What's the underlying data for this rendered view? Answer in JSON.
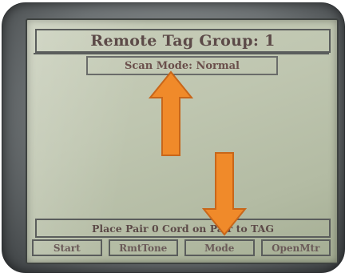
{
  "screen": {
    "title": "Remote Tag Group: 1",
    "scan_mode": "Scan Mode: Normal",
    "status_message": "Place Pair 0 Cord on Pair to TAG"
  },
  "softkeys": [
    {
      "label": "Start"
    },
    {
      "label": "RmtTone"
    },
    {
      "label": "Mode"
    },
    {
      "label": "OpenMtr"
    }
  ],
  "annotations": {
    "arrow_color": "#f08a2a",
    "arrow_up_icon": "arrow-up-icon",
    "arrow_down_icon": "arrow-down-icon"
  },
  "colors": {
    "lcd_background": "#bfc6b0",
    "lcd_text": "#5c4a48",
    "bezel": "#6d7274"
  }
}
